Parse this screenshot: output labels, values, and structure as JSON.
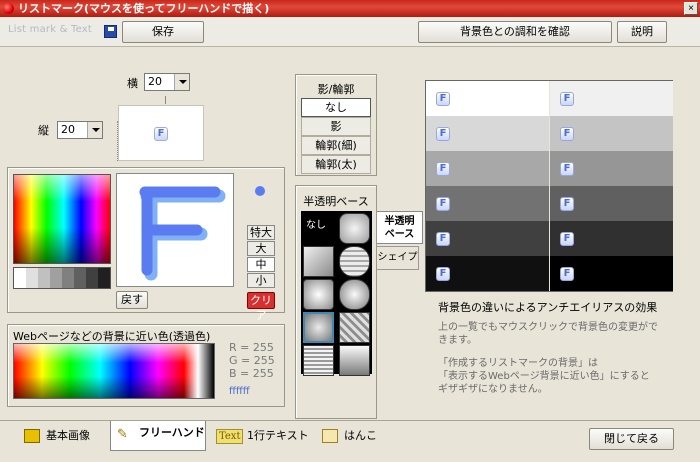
{
  "window": {
    "title": "リストマーク(マウスを使ってフリーハンドで描く)",
    "close_label": "×"
  },
  "toolbar": {
    "logo_text": "List mark & Text",
    "save_label": "保存",
    "check_bg_label": "背景色との調和を確認",
    "help_label": "説明"
  },
  "size": {
    "width_label": "横",
    "width_value": "20",
    "height_label": "縦",
    "height_value": "20",
    "preview_char": "F"
  },
  "canvas": {
    "char": "F",
    "back_label": "戻す",
    "clear_label": "クリア",
    "pen_sizes": [
      "特大",
      "大",
      "中",
      "小"
    ],
    "pen_selected": "中"
  },
  "web_bg": {
    "title": "Webページなどの背景に近い色(透過色)",
    "r": "R = 255",
    "g": "G = 255",
    "b": "B = 255",
    "hex": "ffffff"
  },
  "shadow": {
    "title": "影/輪郭",
    "options": [
      "なし",
      "影",
      "輪郭(細)",
      "輪郭(太)"
    ],
    "selected": "なし"
  },
  "translucent": {
    "title": "半透明ベース",
    "none_label": "なし",
    "side_tab_active": "半透明\nベース",
    "side_tab_inactive": "シェイプ"
  },
  "bg_preview": {
    "caption": "背景色の違いによるアンチエイリアスの効果",
    "note1": "上の一覧でもマウスクリックで背景色の変更ができます。",
    "note2a": "「作成するリストマークの背景」は",
    "note2b": "「表示するWebページ背景に近い色」にすると",
    "note2c": "ギザギザになりません。",
    "char": "F",
    "row_colors": [
      [
        "#ffffff",
        "#f0f0f0"
      ],
      [
        "#d8d8d8",
        "#c4c4c4"
      ],
      [
        "#a8a8a8",
        "#969696"
      ],
      [
        "#727272",
        "#606060"
      ],
      [
        "#404040",
        "#303030"
      ],
      [
        "#101010",
        "#000000"
      ]
    ]
  },
  "tabs": [
    {
      "label": "基本画像",
      "icon": "image-icon"
    },
    {
      "label": "フリーハンド",
      "icon": "freehand-icon"
    },
    {
      "label": "1行テキスト",
      "icon": "text-icon",
      "badge": "Text"
    },
    {
      "label": "はんこ",
      "icon": "stamp-icon"
    }
  ],
  "close_button_label": "閉じて戻る",
  "colors": {
    "titlebar": "#c8281c",
    "canvas_stroke": "#5b7cf0",
    "canvas_stroke_light": "#7fb0f8",
    "clear_button": "#d83030"
  }
}
